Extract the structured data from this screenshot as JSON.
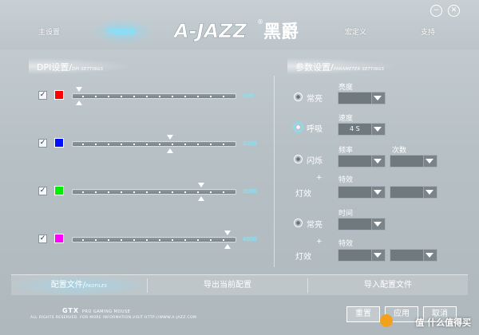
{
  "header": {
    "nav": [
      "主设置",
      "灯效设定",
      "宏定义",
      "支持"
    ],
    "active_nav": "灯效设定",
    "logo_text": "A-JAZZ",
    "logo_cn": "黑爵",
    "logo_mark": "®",
    "window_controls": {
      "minimize": "−",
      "close": "✕"
    }
  },
  "dpi": {
    "title": "DPI设置/",
    "subtitle": "DPI SETTINGS",
    "rows": [
      {
        "color": "#ff0000",
        "value": "400",
        "position": 0.02,
        "checked": true
      },
      {
        "color": "#0010ff",
        "value": "2000",
        "position": 0.6,
        "checked": true
      },
      {
        "color": "#00ee00",
        "value": "3000",
        "position": 0.8,
        "checked": true
      },
      {
        "color": "#ff00ff",
        "value": "4000",
        "position": 0.97,
        "checked": true
      }
    ],
    "check_mark": "✓"
  },
  "params": {
    "title": "参数设置/",
    "subtitle": "PARAMETER SETTINGS",
    "always_on": "常亮",
    "brightness": "亮度",
    "breathing": "呼吸",
    "speed": "速度",
    "speed_value": "4 S",
    "blink": "闪烁",
    "frequency": "频率",
    "count": "次数",
    "plus": "+",
    "light_effect": "灯效",
    "effect": "特效",
    "always_on_2": "常亮",
    "time": "时间",
    "selected_mode": "呼吸"
  },
  "bottom": {
    "profiles_label": "配置文件/",
    "profiles_sub": "PROFILES",
    "export": "导出当前配置",
    "import": "导入配置文件"
  },
  "footer": {
    "brand": "GTX",
    "brand_sub": "PRO GAMING MOUSE",
    "copyright": "ALL RIGHTS RESERVED. FOR MORE INFORMATION,VISIT HTTP://WWW.A-JAZZ.COM"
  },
  "actions": {
    "reset": "重置",
    "apply": "应用",
    "cancel": "取消"
  },
  "watermark": "值 什么值得买",
  "colors": {
    "accent": "#7be6ff",
    "text": "#ffffff",
    "panel": "#b7c0c5"
  }
}
